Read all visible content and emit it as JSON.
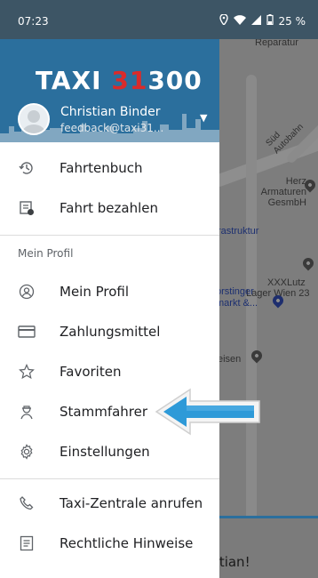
{
  "status_bar": {
    "time": "07:23",
    "battery": "25 %"
  },
  "drawer": {
    "brand": {
      "left": "TAXI ",
      "red": "31",
      "right": "300"
    },
    "user": {
      "name": "Christian Binder",
      "email": "feedback@taxi31..."
    },
    "items_top": [
      {
        "label": "Fahrtenbuch",
        "icon": "history-icon"
      },
      {
        "label": "Fahrt bezahlen",
        "icon": "receipt-pay-icon"
      }
    ],
    "section_title": "Mein Profil",
    "items_profile": [
      {
        "label": "Mein Profil",
        "icon": "profile-icon"
      },
      {
        "label": "Zahlungsmittel",
        "icon": "credit-card-icon"
      },
      {
        "label": "Favoriten",
        "icon": "star-icon"
      },
      {
        "label": "Stammfahrer",
        "icon": "driver-icon"
      },
      {
        "label": "Einstellungen",
        "icon": "gear-icon"
      }
    ],
    "items_bottom": [
      {
        "label": "Taxi-Zentrale anrufen",
        "icon": "phone-icon"
      },
      {
        "label": "Rechtliche Hinweise",
        "icon": "document-icon"
      }
    ]
  },
  "map": {
    "labels": {
      "reparatur": "Reparatur",
      "autobahn": "Süd Autobahn",
      "herz": "Herz Armaturen GesmbH",
      "infra": "rastruktur",
      "xxxlutz": "XXXLutz",
      "lager": "Lager Wien 23",
      "forstinger": "orstinger",
      "markt": "markt &...",
      "eisen": "eisen"
    },
    "card_text": "stian!"
  },
  "colors": {
    "header": "#2b6f9d",
    "status_bar": "#3d5565",
    "arrow": "#2e9ad8",
    "brand_red": "#d92b2b"
  }
}
